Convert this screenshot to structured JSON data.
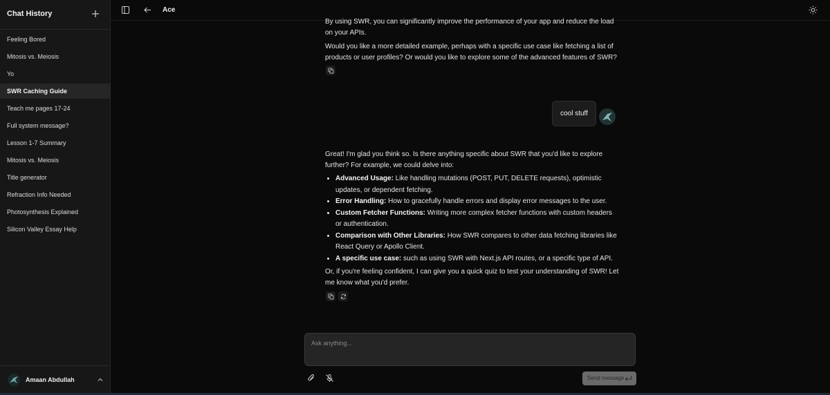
{
  "sidebar": {
    "title": "Chat History",
    "items": [
      {
        "label": "Feeling Bored"
      },
      {
        "label": "Mitosis vs. Meiosis"
      },
      {
        "label": "Yo"
      },
      {
        "label": "SWR Caching Guide"
      },
      {
        "label": "Teach me pages 17-24"
      },
      {
        "label": "Full system message?"
      },
      {
        "label": "Lesson 1-7 Summary"
      },
      {
        "label": "Mitosis vs. Meiosis"
      },
      {
        "label": "Title generator"
      },
      {
        "label": "Refraction Info Needed"
      },
      {
        "label": "Photosynthesis Explained"
      },
      {
        "label": "Silicon Valley Essay Help"
      }
    ],
    "active_index": 3,
    "user_name": "Amaan Abdullah"
  },
  "topbar": {
    "title": "Ace"
  },
  "messages": {
    "assistant1": {
      "p1": "By using SWR, you can significantly improve the performance of your app and reduce the load on your APIs.",
      "p2": "Would you like a more detailed example, perhaps with a specific use case like fetching a list of products or user profiles? Or would you like to explore some of the advanced features of SWR?"
    },
    "user1": {
      "text": "cool stuff"
    },
    "assistant2": {
      "intro": "Great! I'm glad you think so. Is there anything specific about SWR that you'd like to explore further? For example, we could delve into:",
      "points": [
        {
          "bold": "Advanced Usage:",
          "text": " Like handling mutations (POST, PUT, DELETE requests), optimistic updates, or dependent fetching."
        },
        {
          "bold": "Error Handling:",
          "text": " How to gracefully handle errors and display error messages to the user."
        },
        {
          "bold": "Custom Fetcher Functions:",
          "text": " Writing more complex fetcher functions with custom headers or authentication."
        },
        {
          "bold": "Comparison with Other Libraries:",
          "text": " How SWR compares to other data fetching libraries like React Query or Apollo Client."
        },
        {
          "bold": "A specific use case:",
          "text": " such as using SWR with Next.js API routes, or a specific type of API."
        }
      ],
      "outro": "Or, if you're feeling confident, I can give you a quick quiz to test your understanding of SWR! Let me know what you'd prefer."
    }
  },
  "composer": {
    "placeholder": "Ask anything...",
    "value": "",
    "send_label": "Send message"
  },
  "icons": {
    "new_chat": "plus-icon",
    "toggle_sidebar": "sidebar-toggle-icon",
    "back": "arrow-left-icon",
    "theme": "sun-icon",
    "copy": "copy-icon",
    "regenerate": "refresh-icon",
    "attach": "paperclip-icon",
    "mic": "mic-off-icon",
    "enter": "enter-icon",
    "user_menu": "chevron-up-icon"
  },
  "colors": {
    "background": "#0a0a0a",
    "sidebar": "#171717",
    "active_item": "#262626",
    "input": "#252525",
    "send_button": "#6a6a6a"
  }
}
